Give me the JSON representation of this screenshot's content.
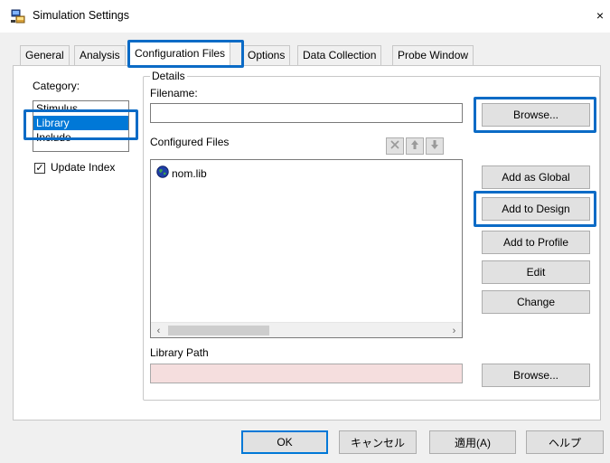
{
  "window": {
    "title": "Simulation Settings",
    "close_glyph": "×",
    "icon": "simulation-app-icon"
  },
  "tabs": [
    {
      "label": "General"
    },
    {
      "label": "Analysis"
    },
    {
      "label": "Configuration Files",
      "active": true
    },
    {
      "label": "Options"
    },
    {
      "label": "Data Collection"
    },
    {
      "label": "Probe Window"
    }
  ],
  "category": {
    "label": "Category:",
    "items": [
      "Stimulus",
      "Library",
      "Include"
    ],
    "selected": "Library",
    "update_index_label": "Update Index",
    "update_index_checked": true
  },
  "details": {
    "legend": "Details",
    "filename_label": "Filename:",
    "filename_value": "",
    "configured_files_label": "Configured Files",
    "files": [
      {
        "name": "nom.lib",
        "icon": "globe-icon"
      }
    ],
    "library_path_label": "Library Path",
    "library_path_value": "",
    "toolbar": {
      "delete": "delete-icon",
      "up": "arrow-up-icon",
      "down": "arrow-down-icon"
    }
  },
  "buttons": {
    "browse_top": "Browse...",
    "add_as_global": "Add as Global",
    "add_to_design": "Add to Design",
    "add_to_profile": "Add to Profile",
    "edit": "Edit",
    "change": "Change",
    "browse_bottom": "Browse..."
  },
  "footer": {
    "ok": "OK",
    "cancel": "キャンセル",
    "apply": "適用(A)",
    "help": "ヘルプ"
  },
  "colors": {
    "highlight": "#0b6bc6",
    "selection": "#0078d7",
    "library_path_bg": "#f5dede"
  }
}
